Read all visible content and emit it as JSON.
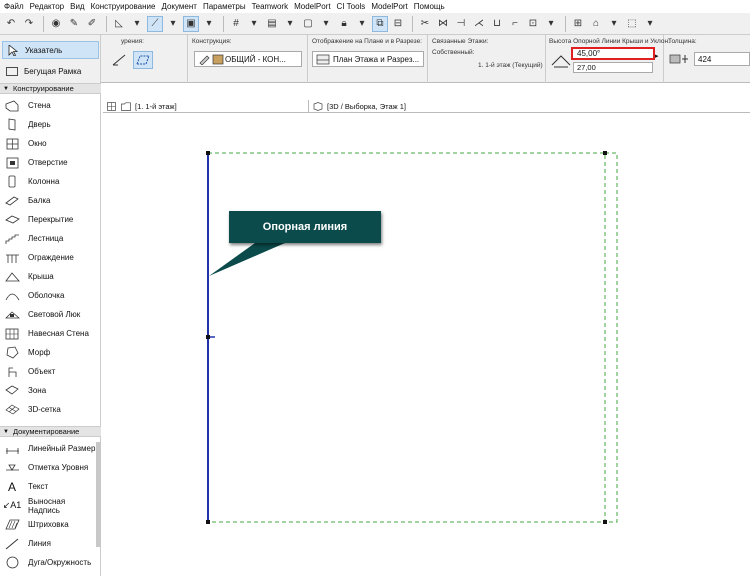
{
  "menu": [
    "Файл",
    "Редактор",
    "Вид",
    "Конструирование",
    "Документ",
    "Параметры",
    "Teamwork",
    "ModelPort",
    "CI Tools",
    "ModelPort",
    "Помощь"
  ],
  "tools_top": [
    {
      "label": "Указатель",
      "icon": "arrow-pointer-icon"
    },
    {
      "label": "Бегущая Рамка",
      "icon": "marquee-icon"
    }
  ],
  "infobox": {
    "geometry_title": "урения:",
    "construction_title": "Конструкция:",
    "construction_value": "ОБЩИЙ - КОН...",
    "display_title": "Отображение на Плане и в Разрезе:",
    "display_value": "План Этажа и Разрез...",
    "linked_title": "Связанные Этажи:",
    "own_label": "Собственный:",
    "own_value": "1. 1-й этаж (Текущий)",
    "height_title": "Высота Опорной Линии Крыши и Уклон:",
    "angle_value": "45,00°",
    "height_value": "27,00",
    "thickness_title": "Толщина:",
    "thickness_value": "424"
  },
  "palette": {
    "section_construct": "Конструирование",
    "construct_items": [
      {
        "label": "Стена",
        "icon": "wall-icon"
      },
      {
        "label": "Дверь",
        "icon": "door-icon"
      },
      {
        "label": "Окно",
        "icon": "window-icon"
      },
      {
        "label": "Отверстие",
        "icon": "opening-icon"
      },
      {
        "label": "Колонна",
        "icon": "column-icon"
      },
      {
        "label": "Балка",
        "icon": "beam-icon"
      },
      {
        "label": "Перекрытие",
        "icon": "slab-icon"
      },
      {
        "label": "Лестница",
        "icon": "stair-icon"
      },
      {
        "label": "Ограждение",
        "icon": "railing-icon"
      },
      {
        "label": "Крыша",
        "icon": "roof-icon"
      },
      {
        "label": "Оболочка",
        "icon": "shell-icon"
      },
      {
        "label": "Световой Люк",
        "icon": "skylight-icon"
      },
      {
        "label": "Навесная Стена",
        "icon": "curtain-wall-icon"
      },
      {
        "label": "Морф",
        "icon": "morph-icon"
      },
      {
        "label": "Объект",
        "icon": "object-icon"
      },
      {
        "label": "Зона",
        "icon": "zone-icon"
      },
      {
        "label": "3D-сетка",
        "icon": "mesh-icon"
      }
    ],
    "section_document": "Документирование",
    "document_items": [
      {
        "label": "Линейный Размер",
        "icon": "dimension-icon"
      },
      {
        "label": "Отметка Уровня",
        "icon": "level-marker-icon"
      },
      {
        "label": "Текст",
        "icon": "text-icon"
      },
      {
        "label": "Выносная Надпись",
        "icon": "label-icon"
      },
      {
        "label": "Штриховка",
        "icon": "fill-icon"
      },
      {
        "label": "Линия",
        "icon": "line-icon"
      },
      {
        "label": "Дуга/Окружность",
        "icon": "circle-icon"
      }
    ]
  },
  "tabs": [
    {
      "label": "[1. 1-й этаж]",
      "icon": "floor-plan-icon"
    },
    {
      "label": "[3D / Выборка, Этаж 1]",
      "icon": "3d-view-icon"
    }
  ],
  "callout": "Опорная линия",
  "colors": {
    "reference_line": "#2233aa",
    "roof_outline": "#44aa44",
    "callout_bg": "#0b4b4b",
    "highlight": "#e02020"
  }
}
